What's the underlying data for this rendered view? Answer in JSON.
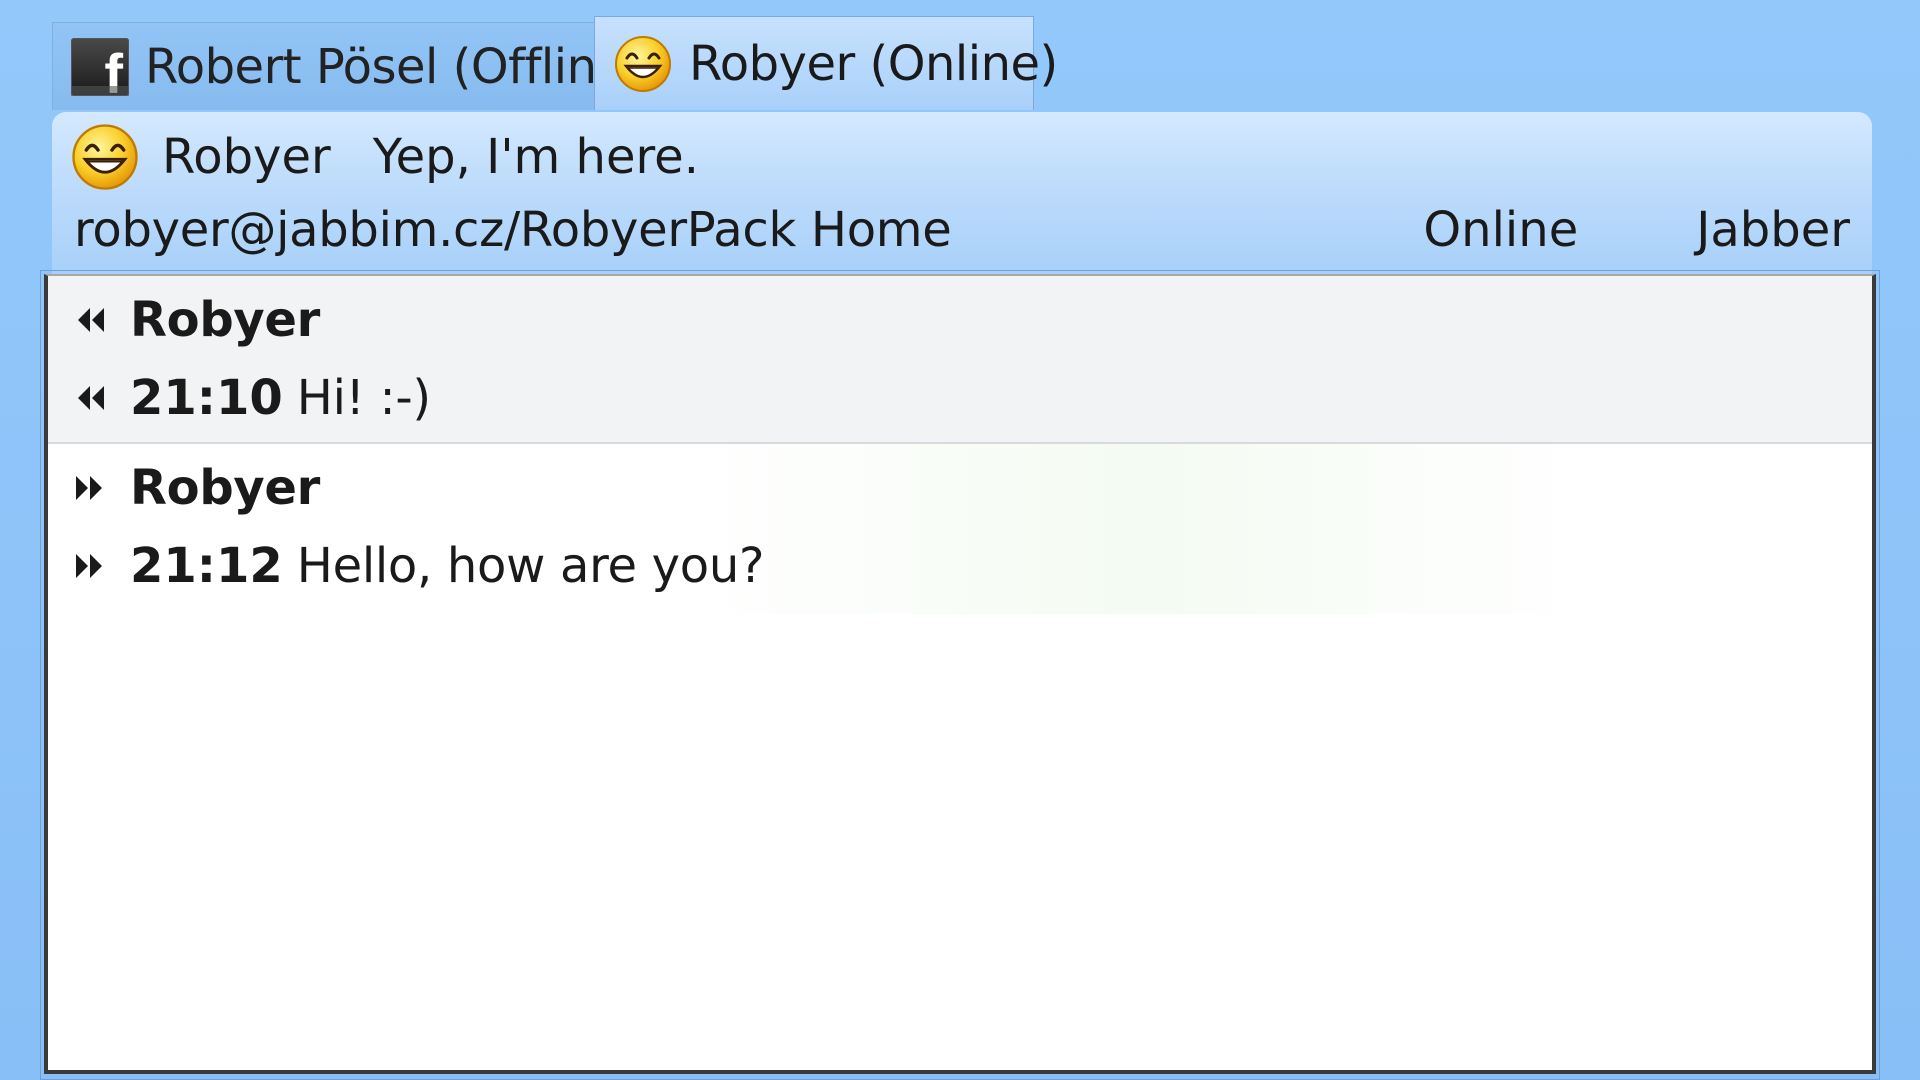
{
  "tabs": [
    {
      "label": "Robert Pösel (Offline)",
      "icon": "facebook-icon",
      "active": false
    },
    {
      "label": "Robyer (Online)",
      "icon": "smiley-icon",
      "active": true
    }
  ],
  "contact": {
    "nick": "Robyer",
    "status_message": "Yep, I'm here.",
    "jid": "robyer@jabbim.cz/RobyerPack Home",
    "status": "Online",
    "protocol": "Jabber"
  },
  "messages": [
    {
      "direction": "incoming",
      "sender": "Robyer",
      "time": "21:10",
      "text": "Hi! :-)"
    },
    {
      "direction": "outgoing",
      "sender": "Robyer",
      "time": "21:12",
      "text": "Hello, how are you?"
    }
  ],
  "colors": {
    "window_bg": "#8ec3f8",
    "active_tab": "#c7e1fd",
    "incoming_bg": "#f2f3f5",
    "outgoing_bg": "#ffffff"
  }
}
